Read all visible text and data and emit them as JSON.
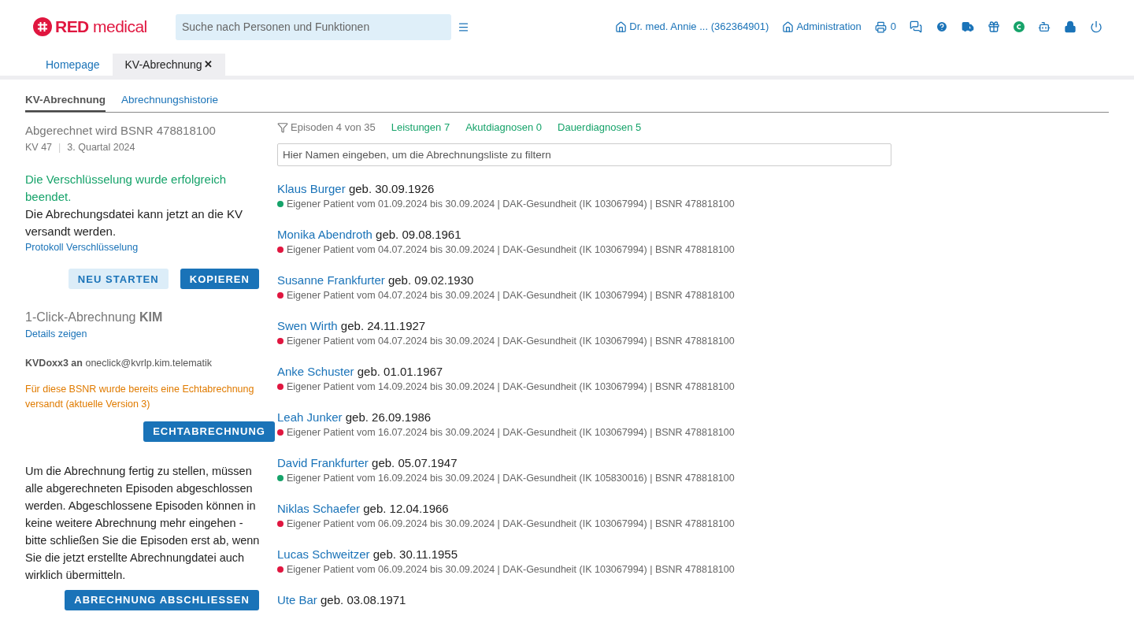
{
  "logo": {
    "bold": "RED",
    "light": "medical"
  },
  "search": {
    "placeholder": "Suche nach Personen und Funktionen"
  },
  "header": {
    "user": "Dr. med. Annie ... (362364901)",
    "admin": "Administration",
    "print_count": "0",
    "icons": [
      {
        "kind": "chat"
      },
      {
        "kind": "help"
      },
      {
        "kind": "truck"
      },
      {
        "kind": "gift"
      },
      {
        "kind": "badge"
      },
      {
        "kind": "robot"
      },
      {
        "kind": "lock"
      },
      {
        "kind": "power"
      }
    ]
  },
  "tabs": [
    {
      "label": "Homepage",
      "selected": false
    },
    {
      "label": "KV-Abrechnung",
      "selected": true,
      "close": "✕"
    }
  ],
  "subtabs": [
    {
      "label": "KV-Abrechnung",
      "selected": true
    },
    {
      "label": "Abrechnungshistorie",
      "selected": false
    }
  ],
  "left": {
    "title": "Abgerechnet wird BSNR 478818100",
    "kv": "KV 47",
    "separator": "|",
    "quarter": "3. Quartal 2024",
    "success": "Die Verschlüsselung wurde erfolgreich beendet.",
    "info": "Die Abrechungsdatei kann jetzt an die KV versandt werden.",
    "protocol_link": "Protokoll Verschlüsselung",
    "buttons": [
      {
        "label": "NEU STARTEN",
        "kind": "secondary"
      },
      {
        "label": "KOPIEREN",
        "kind": "primary"
      }
    ],
    "kim_title": "1-Click-Abrechnung **KIM**",
    "details_link": "Details zeigen",
    "kim_sender": "**KVDoxx3 an** oneclick@kvrlp.kim.telematik",
    "warning": "Für diese BSNR wurde bereits eine Echtabrechnung versandt (aktuelle Version 3)",
    "echt_button": "ECHTABRECHNUNG",
    "note": "Um die Abrechnung fertig zu stellen, müssen alle abgerechneten Episoden abgeschlossen werden. Abgeschlossene Episoden können in keine weitere Abrechnung mehr eingehen - bitte schließen Sie die Episoden erst ab, wenn Sie die jetzt erstellte Abrechnungdatei auch wirklich übermitteln.",
    "finish_button": "ABRECHNUNG ABSCHLIESSEN"
  },
  "filters": {
    "episodes": "Episoden 4 von 35",
    "links": [
      "Leistungen 7",
      "Akutdiagnosen 0",
      "Dauerdiagnosen 5"
    ],
    "placeholder": "Hier Namen eingeben, um die Abrechnungsliste zu filtern"
  },
  "patients": [
    {
      "name": "Klaus Burger",
      "birth": "geb. 30.09.1926",
      "color": "#16a36a",
      "details": "Eigener Patient vom 01.09.2024 bis 30.09.2024 | DAK-Gesundheit (IK 103067994) | BSNR 478818100"
    },
    {
      "name": "Monika Abendroth",
      "birth": "geb. 09.08.1961",
      "color": "#e0163f",
      "details": "Eigener Patient vom 04.07.2024 bis 30.09.2024 | DAK-Gesundheit (IK 103067994) | BSNR 478818100"
    },
    {
      "name": "Susanne Frankfurter",
      "birth": "geb. 09.02.1930",
      "color": "#e0163f",
      "details": "Eigener Patient vom 04.07.2024 bis 30.09.2024 | DAK-Gesundheit (IK 103067994) | BSNR 478818100"
    },
    {
      "name": "Swen Wirth",
      "birth": "geb. 24.11.1927",
      "color": "#e0163f",
      "details": "Eigener Patient vom 04.07.2024 bis 30.09.2024 | DAK-Gesundheit (IK 103067994) | BSNR 478818100"
    },
    {
      "name": "Anke Schuster",
      "birth": "geb. 01.01.1967",
      "color": "#e0163f",
      "details": "Eigener Patient vom 14.09.2024 bis 30.09.2024 | DAK-Gesundheit (IK 103067994) | BSNR 478818100"
    },
    {
      "name": "Leah Junker",
      "birth": "geb. 26.09.1986",
      "color": "#e0163f",
      "details": "Eigener Patient vom 16.07.2024 bis 30.09.2024 | DAK-Gesundheit (IK 103067994) | BSNR 478818100"
    },
    {
      "name": "David Frankfurter",
      "birth": "geb. 05.07.1947",
      "color": "#16a36a",
      "details": "Eigener Patient vom 16.09.2024 bis 30.09.2024 | DAK-Gesundheit (IK 105830016) | BSNR 478818100"
    },
    {
      "name": "Niklas Schaefer",
      "birth": "geb. 12.04.1966",
      "color": "#e0163f",
      "details": "Eigener Patient vom 06.09.2024 bis 30.09.2024 | DAK-Gesundheit (IK 103067994) | BSNR 478818100"
    },
    {
      "name": "Lucas Schweitzer",
      "birth": "geb. 30.11.1955",
      "color": "#e0163f",
      "details": "Eigener Patient vom 06.09.2024 bis 30.09.2024 | DAK-Gesundheit (IK 103067994) | BSNR 478818100"
    },
    {
      "name": "Ute Bar",
      "birth": "geb. 03.08.1971"
    }
  ]
}
